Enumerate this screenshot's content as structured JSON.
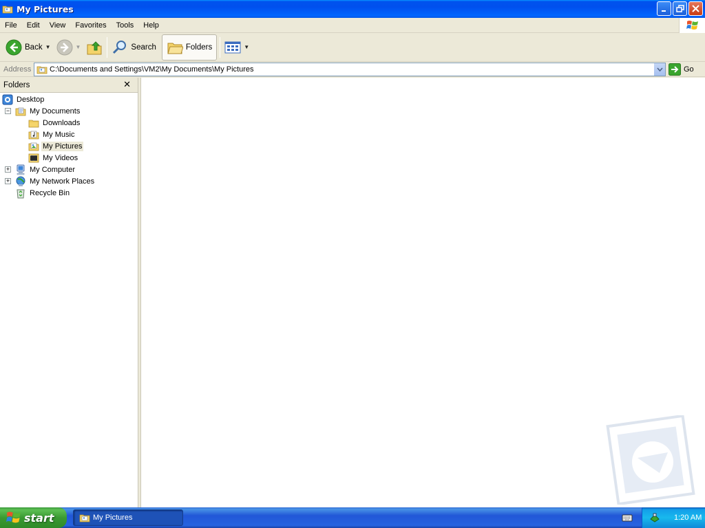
{
  "window": {
    "title": "My Pictures"
  },
  "menu": {
    "items": [
      "File",
      "Edit",
      "View",
      "Favorites",
      "Tools",
      "Help"
    ]
  },
  "toolbar": {
    "back_label": "Back",
    "search_label": "Search",
    "folders_label": "Folders"
  },
  "address": {
    "label": "Address",
    "value": "C:\\Documents and Settings\\VM2\\My Documents\\My Pictures",
    "go_label": "Go"
  },
  "folders_pane": {
    "title": "Folders",
    "tree": [
      {
        "label": "Desktop",
        "icon": "desktop-icon"
      },
      {
        "label": "My Documents",
        "icon": "my-documents-icon",
        "expander": "−"
      },
      {
        "label": "Downloads",
        "icon": "folder-icon"
      },
      {
        "label": "My Music",
        "icon": "music-folder-icon"
      },
      {
        "label": "My Pictures",
        "icon": "pictures-folder-icon",
        "selected": true
      },
      {
        "label": "My Videos",
        "icon": "videos-folder-icon"
      },
      {
        "label": "My Computer",
        "icon": "computer-icon",
        "expander": "+"
      },
      {
        "label": "My Network Places",
        "icon": "network-icon",
        "expander": "+"
      },
      {
        "label": "Recycle Bin",
        "icon": "recycle-bin-icon"
      }
    ]
  },
  "taskbar": {
    "start_label": "start",
    "task_label": "My Pictures",
    "clock": "1:20 AM"
  }
}
